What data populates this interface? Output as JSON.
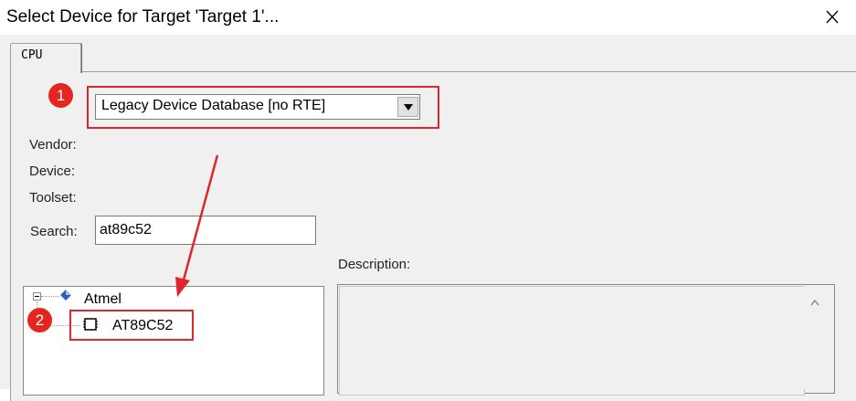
{
  "window": {
    "title": "Select Device for Target 'Target 1'...",
    "close_glyph": "✕"
  },
  "tabs": [
    {
      "label": "CPU"
    }
  ],
  "database": {
    "selected": "Legacy Device Database [no RTE]"
  },
  "fields": {
    "vendor_label": "Vendor:",
    "device_label": "Device:",
    "toolset_label": "Toolset:",
    "search_label": "Search:",
    "search_value": "at89c52"
  },
  "description": {
    "label": "Description:"
  },
  "tree": {
    "vendor": "Atmel",
    "device": "AT89C52",
    "vendor_icon": "diamond-vendor-icon",
    "device_icon": "chip-icon"
  },
  "annotations": {
    "marker1": "1",
    "marker2": "2",
    "color": "#e0262b"
  }
}
